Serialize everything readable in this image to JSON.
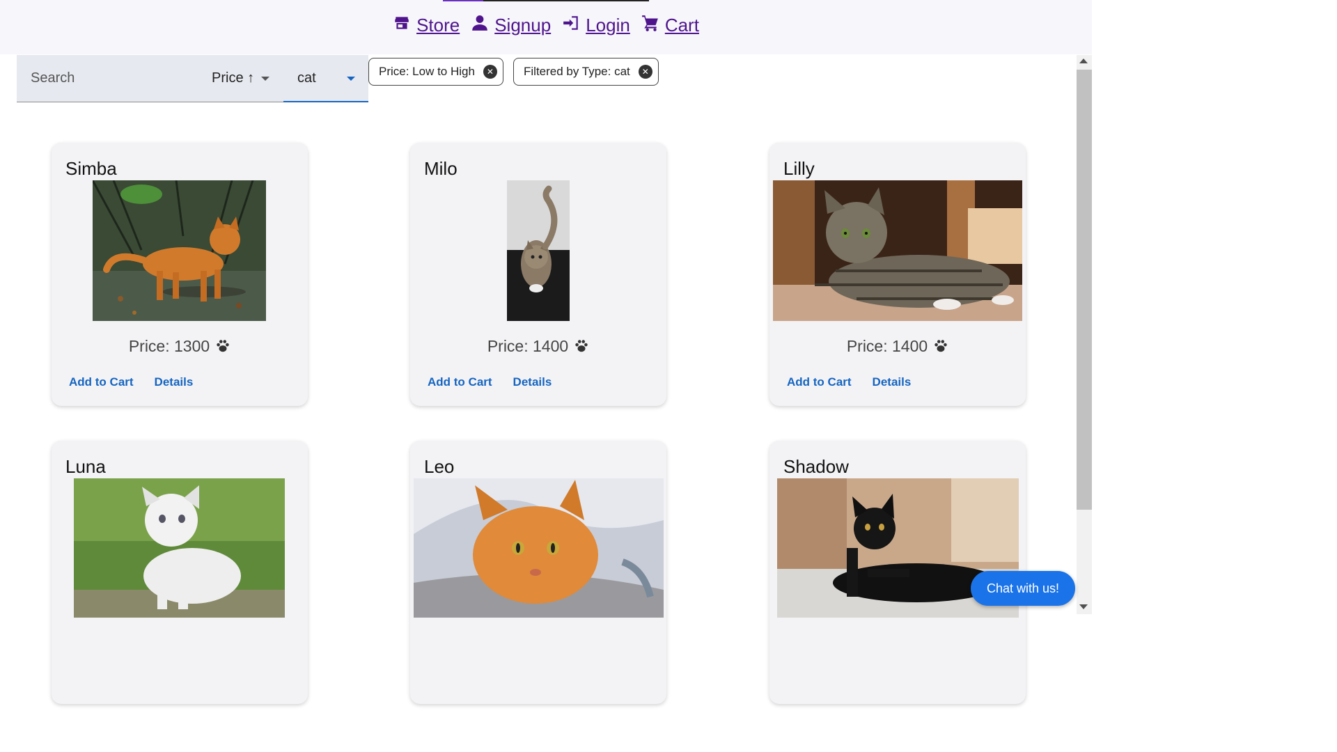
{
  "nav": {
    "links": [
      {
        "label": "Store",
        "icon": "store-icon"
      },
      {
        "label": "Signup",
        "icon": "person-icon"
      },
      {
        "label": "Login",
        "icon": "login-icon"
      },
      {
        "label": "Cart",
        "icon": "cart-icon"
      }
    ]
  },
  "filters": {
    "search_placeholder": "Search",
    "search_value": "",
    "sort_value": "Price ↑",
    "type_value": "cat",
    "chips": [
      {
        "label": "Price: Low to High"
      },
      {
        "label": "Filtered by Type: cat"
      }
    ]
  },
  "products": [
    {
      "name": "Simba",
      "price_text": "Price: 1300",
      "add_label": "Add to Cart",
      "details_label": "Details"
    },
    {
      "name": "Milo",
      "price_text": "Price: 1400",
      "add_label": "Add to Cart",
      "details_label": "Details"
    },
    {
      "name": "Lilly",
      "price_text": "Price: 1400",
      "add_label": "Add to Cart",
      "details_label": "Details"
    },
    {
      "name": "Luna",
      "price_text": "",
      "add_label": "",
      "details_label": ""
    },
    {
      "name": "Leo",
      "price_text": "",
      "add_label": "",
      "details_label": ""
    },
    {
      "name": "Shadow",
      "price_text": "",
      "add_label": "",
      "details_label": ""
    }
  ],
  "chat": {
    "label": "Chat with us!"
  },
  "colors": {
    "nav_link": "#4f148c",
    "action_link": "#1565c0",
    "chat_button": "#1a73e8",
    "card_bg": "#f3f3f6"
  }
}
